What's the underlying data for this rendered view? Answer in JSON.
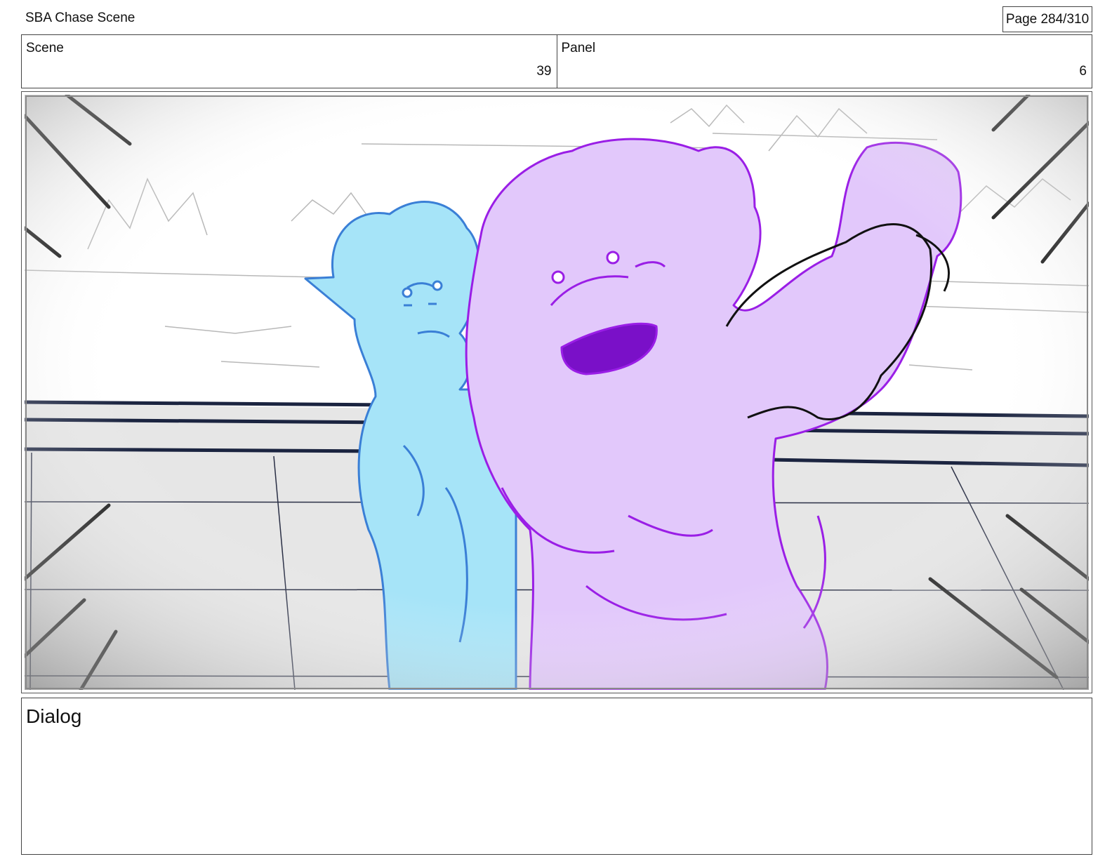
{
  "document_title": "SBA Chase Scene",
  "page_indicator": "Page 284/310",
  "scene": {
    "label": "Scene",
    "value": "39"
  },
  "panel": {
    "label": "Panel",
    "value": "6"
  },
  "dialog": {
    "label": "Dialog",
    "text": ""
  },
  "colors": {
    "left_character_fill": "#a6e4f8",
    "left_character_line": "#3a7fd6",
    "right_character_fill": "#e2c8fb",
    "right_character_line": "#9a1ee6",
    "ring_ropes": "#1b2440",
    "speed_lines": "#111111"
  }
}
